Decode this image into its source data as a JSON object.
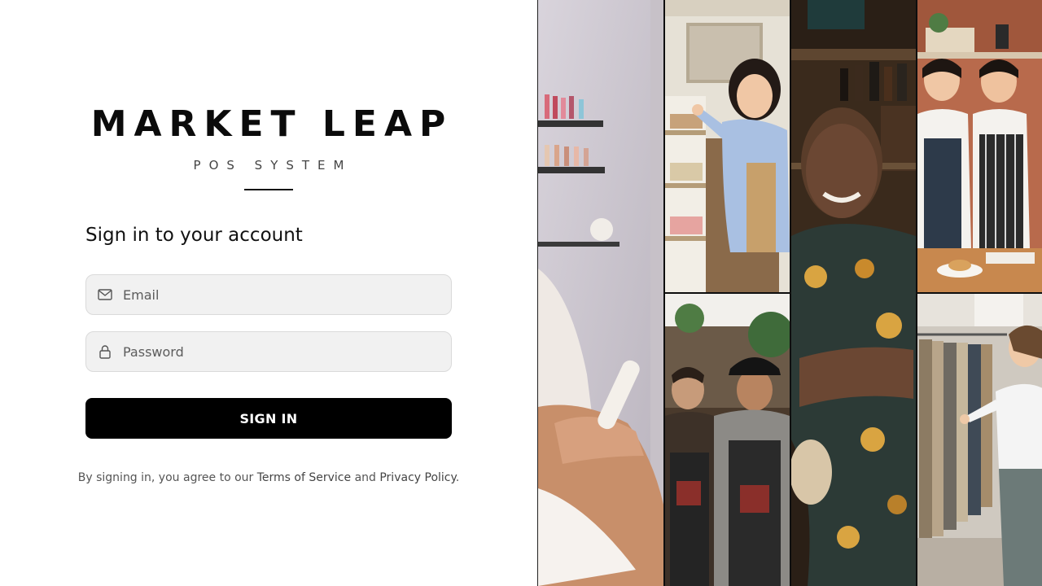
{
  "brand": {
    "title": "MARKET LEAP",
    "subtitle": "POS SYSTEM"
  },
  "form": {
    "heading": "Sign in to your account",
    "email_placeholder": "Email",
    "password_placeholder": "Password",
    "submit_label": "SIGN IN",
    "icons": {
      "email": "mail-icon",
      "password": "lock-icon"
    }
  },
  "legal": {
    "prefix": "By signing in, you agree to our",
    "terms_link": "Terms of Service",
    "conjunction": "and",
    "privacy_link": "Privacy Policy",
    "suffix": "."
  },
  "gallery": {
    "photos": [
      "nail-salon-photo",
      "shop-owner-restocking-photo",
      "smiling-man-floral-shirt-photo",
      "cafe-owners-aprons-photo",
      "barbers-aprons-photo",
      "clothing-store-browsing-photo"
    ]
  },
  "colors": {
    "button_bg": "#000000",
    "button_text": "#ffffff",
    "field_bg": "#f1f1f1",
    "field_border": "#dadada"
  }
}
